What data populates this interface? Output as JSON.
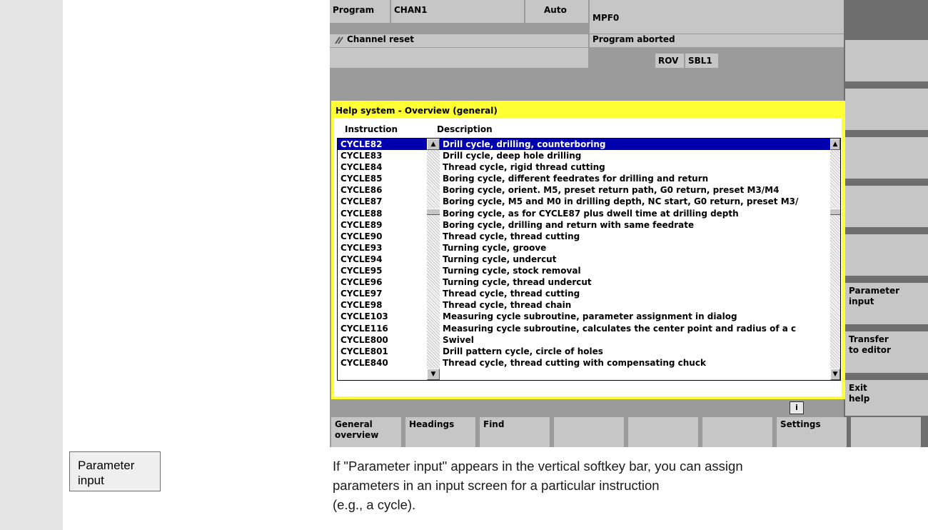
{
  "side_button": {
    "line1": "Parameter",
    "line2": "input"
  },
  "description": [
    "If \"Parameter input\" appears in the vertical softkey bar, you can assign",
    "parameters in an input screen for a particular instruction",
    "(e.g., a cycle)."
  ],
  "header": {
    "area": "Program",
    "channel": "CHAN1",
    "mode": "Auto",
    "program": "MPF0",
    "channel_status": "Channel reset",
    "program_status": "Program aborted",
    "flag_rov": "ROV",
    "flag_sbl": "SBL1"
  },
  "help": {
    "title": "Help system - Overview (general)",
    "col_instruction": "Instruction",
    "col_description": "Description",
    "rows": [
      {
        "instr": "CYCLE82",
        "desc": "Drill cycle, drilling, counterboring"
      },
      {
        "instr": "CYCLE83",
        "desc": "Drill cycle, deep hole drilling"
      },
      {
        "instr": "CYCLE84",
        "desc": "Thread cycle, rigid thread cutting"
      },
      {
        "instr": "CYCLE85",
        "desc": "Boring cycle, different feedrates for drilling and return"
      },
      {
        "instr": "CYCLE86",
        "desc": "Boring cycle, orient. M5, preset return path, G0 return, preset M3/M4"
      },
      {
        "instr": "CYCLE87",
        "desc": "Boring cycle, M5 and M0 in drilling depth, NC start, G0 return, preset M3/"
      },
      {
        "instr": "CYCLE88",
        "desc": "Boring cycle, as for CYCLE87 plus dwell time at drilling depth"
      },
      {
        "instr": "CYCLE89",
        "desc": "Boring cycle, drilling and return with same feedrate"
      },
      {
        "instr": "CYCLE90",
        "desc": "Thread cycle, thread cutting"
      },
      {
        "instr": "CYCLE93",
        "desc": "Turning cycle, groove"
      },
      {
        "instr": "CYCLE94",
        "desc": "Turning cycle, undercut"
      },
      {
        "instr": "CYCLE95",
        "desc": "Turning cycle, stock removal"
      },
      {
        "instr": "CYCLE96",
        "desc": "Turning cycle, thread undercut"
      },
      {
        "instr": "CYCLE97",
        "desc": "Thread cycle, thread cutting"
      },
      {
        "instr": "CYCLE98",
        "desc": "Thread cycle, thread chain"
      },
      {
        "instr": "CYCLE103",
        "desc": "Measuring cycle subroutine, parameter assignment in dialog"
      },
      {
        "instr": "CYCLE116",
        "desc": "Measuring cycle subroutine, calculates the center point and radius of a c"
      },
      {
        "instr": "CYCLE800",
        "desc": "Swivel"
      },
      {
        "instr": "CYCLE801",
        "desc": "Drill pattern cycle, circle of holes"
      },
      {
        "instr": "CYCLE840",
        "desc": "Thread cycle, thread cutting with compensating chuck"
      }
    ]
  },
  "vertical_softkeys": {
    "param_line1": "Parameter",
    "param_line2": "input",
    "transfer_line1": "Transfer",
    "transfer_line2": "to editor",
    "exit_line1": "Exit",
    "exit_line2": "help"
  },
  "info_key": "i",
  "horizontal_softkeys": {
    "general_line1": "General",
    "general_line2": "overview",
    "headings": "Headings",
    "find": "Find",
    "settings": "Settings"
  },
  "colors": {
    "selection": "#0000b0",
    "title_bar": "#ffff33",
    "softkey": "#c6c6c6",
    "background": "#9b9b9b"
  }
}
